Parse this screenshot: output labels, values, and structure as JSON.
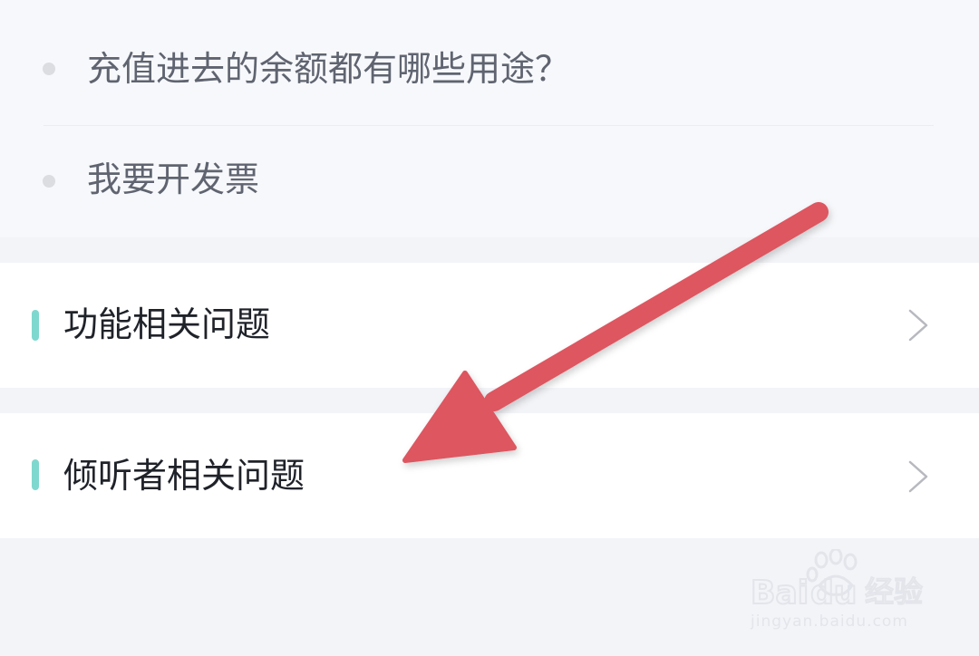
{
  "faq_list": {
    "items": [
      {
        "text": "充值进去的余额都有哪些用途？"
      },
      {
        "text": "我要开发票"
      }
    ]
  },
  "categories": [
    {
      "label": "功能相关问题",
      "icon": "chevron-right-icon"
    },
    {
      "label": "倾听者相关问题",
      "icon": "chevron-right-icon"
    }
  ],
  "colors": {
    "accent_bar": "#7fd8cf",
    "annotation_arrow": "#dd5760",
    "page_background": "#f3f4f8"
  },
  "watermark": {
    "brand": "Baidu经验",
    "url": "jingyan.baidu.com"
  }
}
